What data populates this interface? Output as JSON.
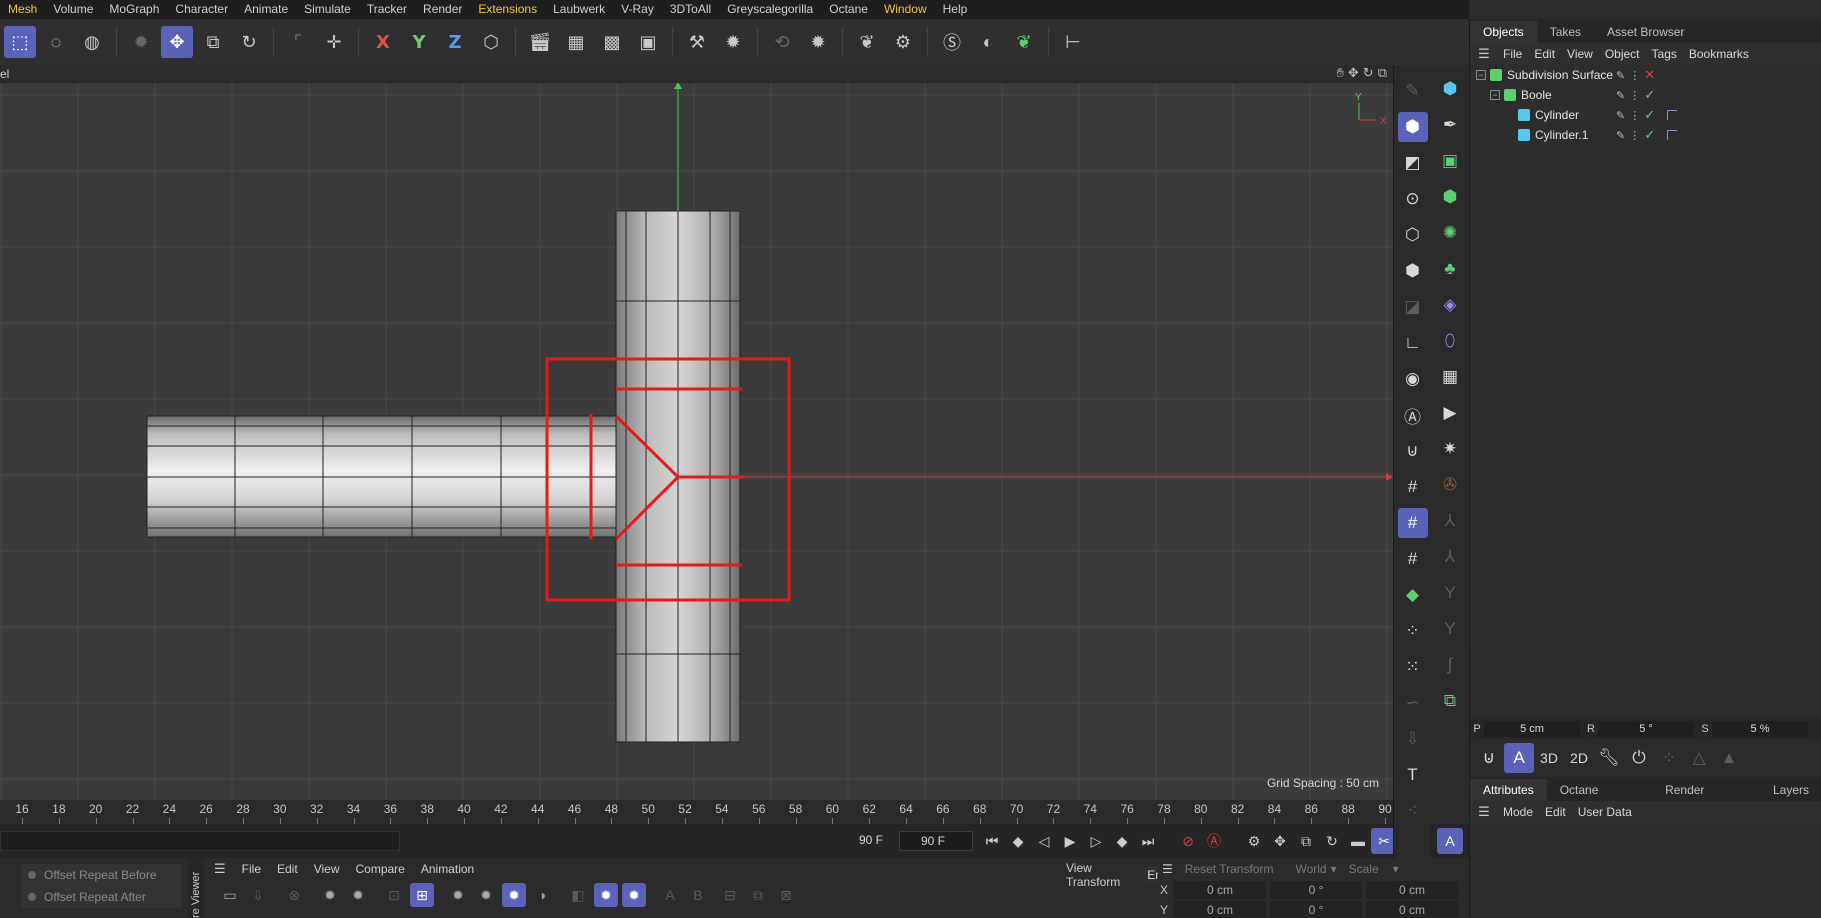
{
  "menubar": [
    "Mesh",
    "Volume",
    "MoGraph",
    "Character",
    "Animate",
    "Simulate",
    "Tracker",
    "Render",
    "Extensions",
    "Laubwerk",
    "V-Ray",
    "3DToAll",
    "Greyscalegorilla",
    "Octane",
    "Window",
    "Help"
  ],
  "highlighted_menus": [
    "Mesh",
    "Extensions",
    "Window"
  ],
  "toolbar": {
    "axis_x": "X",
    "axis_y": "Y",
    "axis_z": "Z"
  },
  "viewport": {
    "label": "el",
    "grid_spacing": "Grid Spacing : 50 cm",
    "gizmo_y": "Y",
    "gizmo_x": "X"
  },
  "timeline": {
    "ticks": [
      "16",
      "18",
      "20",
      "22",
      "24",
      "26",
      "28",
      "30",
      "32",
      "34",
      "36",
      "38",
      "40",
      "42",
      "44",
      "46",
      "48",
      "50",
      "52",
      "54",
      "56",
      "58",
      "60",
      "62",
      "64",
      "66",
      "68",
      "70",
      "72",
      "74",
      "76",
      "78",
      "80",
      "82",
      "84",
      "86",
      "88",
      "90"
    ],
    "current_frame": "90 F",
    "end_frame": "90 F"
  },
  "bottom_left": {
    "rows": [
      "Offset Repeat Before",
      "Offset Repeat After"
    ]
  },
  "picture_viewer": {
    "tab_label": "re Viewer",
    "menu": [
      "File",
      "Edit",
      "View",
      "Compare",
      "Animation"
    ],
    "view_transform_label": "View Transform",
    "view_transform_value": "Embedded"
  },
  "coordinates": {
    "header": [
      "Reset Transform",
      "World",
      "Scale"
    ],
    "row_x_label": "X",
    "row_x": [
      "0 cm",
      "0 °",
      "0 cm"
    ],
    "row_y_label": "Y",
    "row_y": [
      "0 cm",
      "0 °",
      "0 cm"
    ]
  },
  "right_panel": {
    "tabs": [
      "Objects",
      "Takes",
      "Asset Browser"
    ],
    "active_tab": "Objects",
    "menu": [
      "File",
      "Edit",
      "View",
      "Object",
      "Tags",
      "Bookmarks"
    ],
    "objects": [
      {
        "name": "Subdivision Surface",
        "indent": 0,
        "icon_color": "#5fd070",
        "status": "x"
      },
      {
        "name": "Boole",
        "indent": 1,
        "icon_color": "#5fd070",
        "status": "check"
      },
      {
        "name": "Cylinder",
        "indent": 2,
        "icon_color": "#56c8f0",
        "status": "check"
      },
      {
        "name": "Cylinder.1",
        "indent": 2,
        "icon_color": "#56c8f0",
        "status": "check"
      }
    ],
    "pvs": {
      "p_label": "P",
      "p_value": "5 cm",
      "r_label": "R",
      "r_value": "5 °",
      "s_label": "S",
      "s_value": "5 %"
    },
    "mode_buttons": [
      "A",
      "3D",
      "2D"
    ],
    "attr_tabs": [
      "Attributes",
      "Octane settings",
      "Render Settings",
      "Layers"
    ],
    "attr_active": "Attributes",
    "attr_menu": [
      "Mode",
      "Edit",
      "User Data"
    ]
  },
  "colors": {
    "accent": "#5a63b8",
    "selection_red": "#e01c1c",
    "axis_green": "#3fd05a",
    "axis_red": "#d03c3c"
  }
}
